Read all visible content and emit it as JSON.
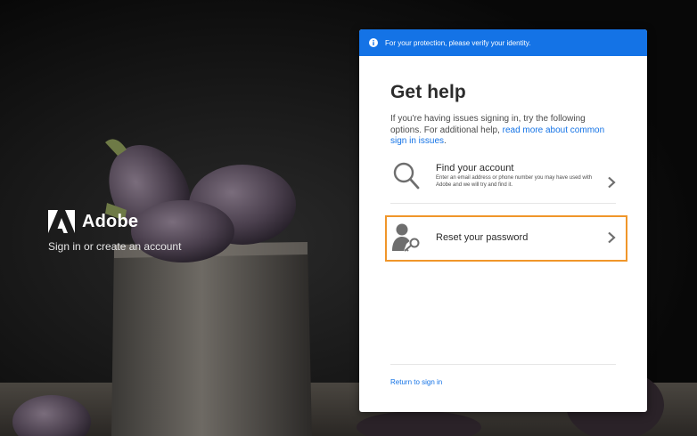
{
  "brand": {
    "name": "Adobe",
    "tagline": "Sign in or create an account"
  },
  "banner": {
    "text": "For your protection, please verify your identity."
  },
  "card": {
    "title": "Get help",
    "intro_text": "If you're having issues signing in, try the following options. For additional help, ",
    "intro_link": "read more about common sign in issues",
    "intro_end": "."
  },
  "options": [
    {
      "title": "Find your account",
      "description": "Enter an email address or phone number you may have used with Adobe and we will try and find it.",
      "icon": "magnifier-icon"
    },
    {
      "title": "Reset your password",
      "description": "",
      "icon": "person-key-icon"
    }
  ],
  "footer": {
    "return_link": "Return to sign in"
  },
  "colors": {
    "accent": "#1473e6",
    "highlight": "#f0962a"
  }
}
